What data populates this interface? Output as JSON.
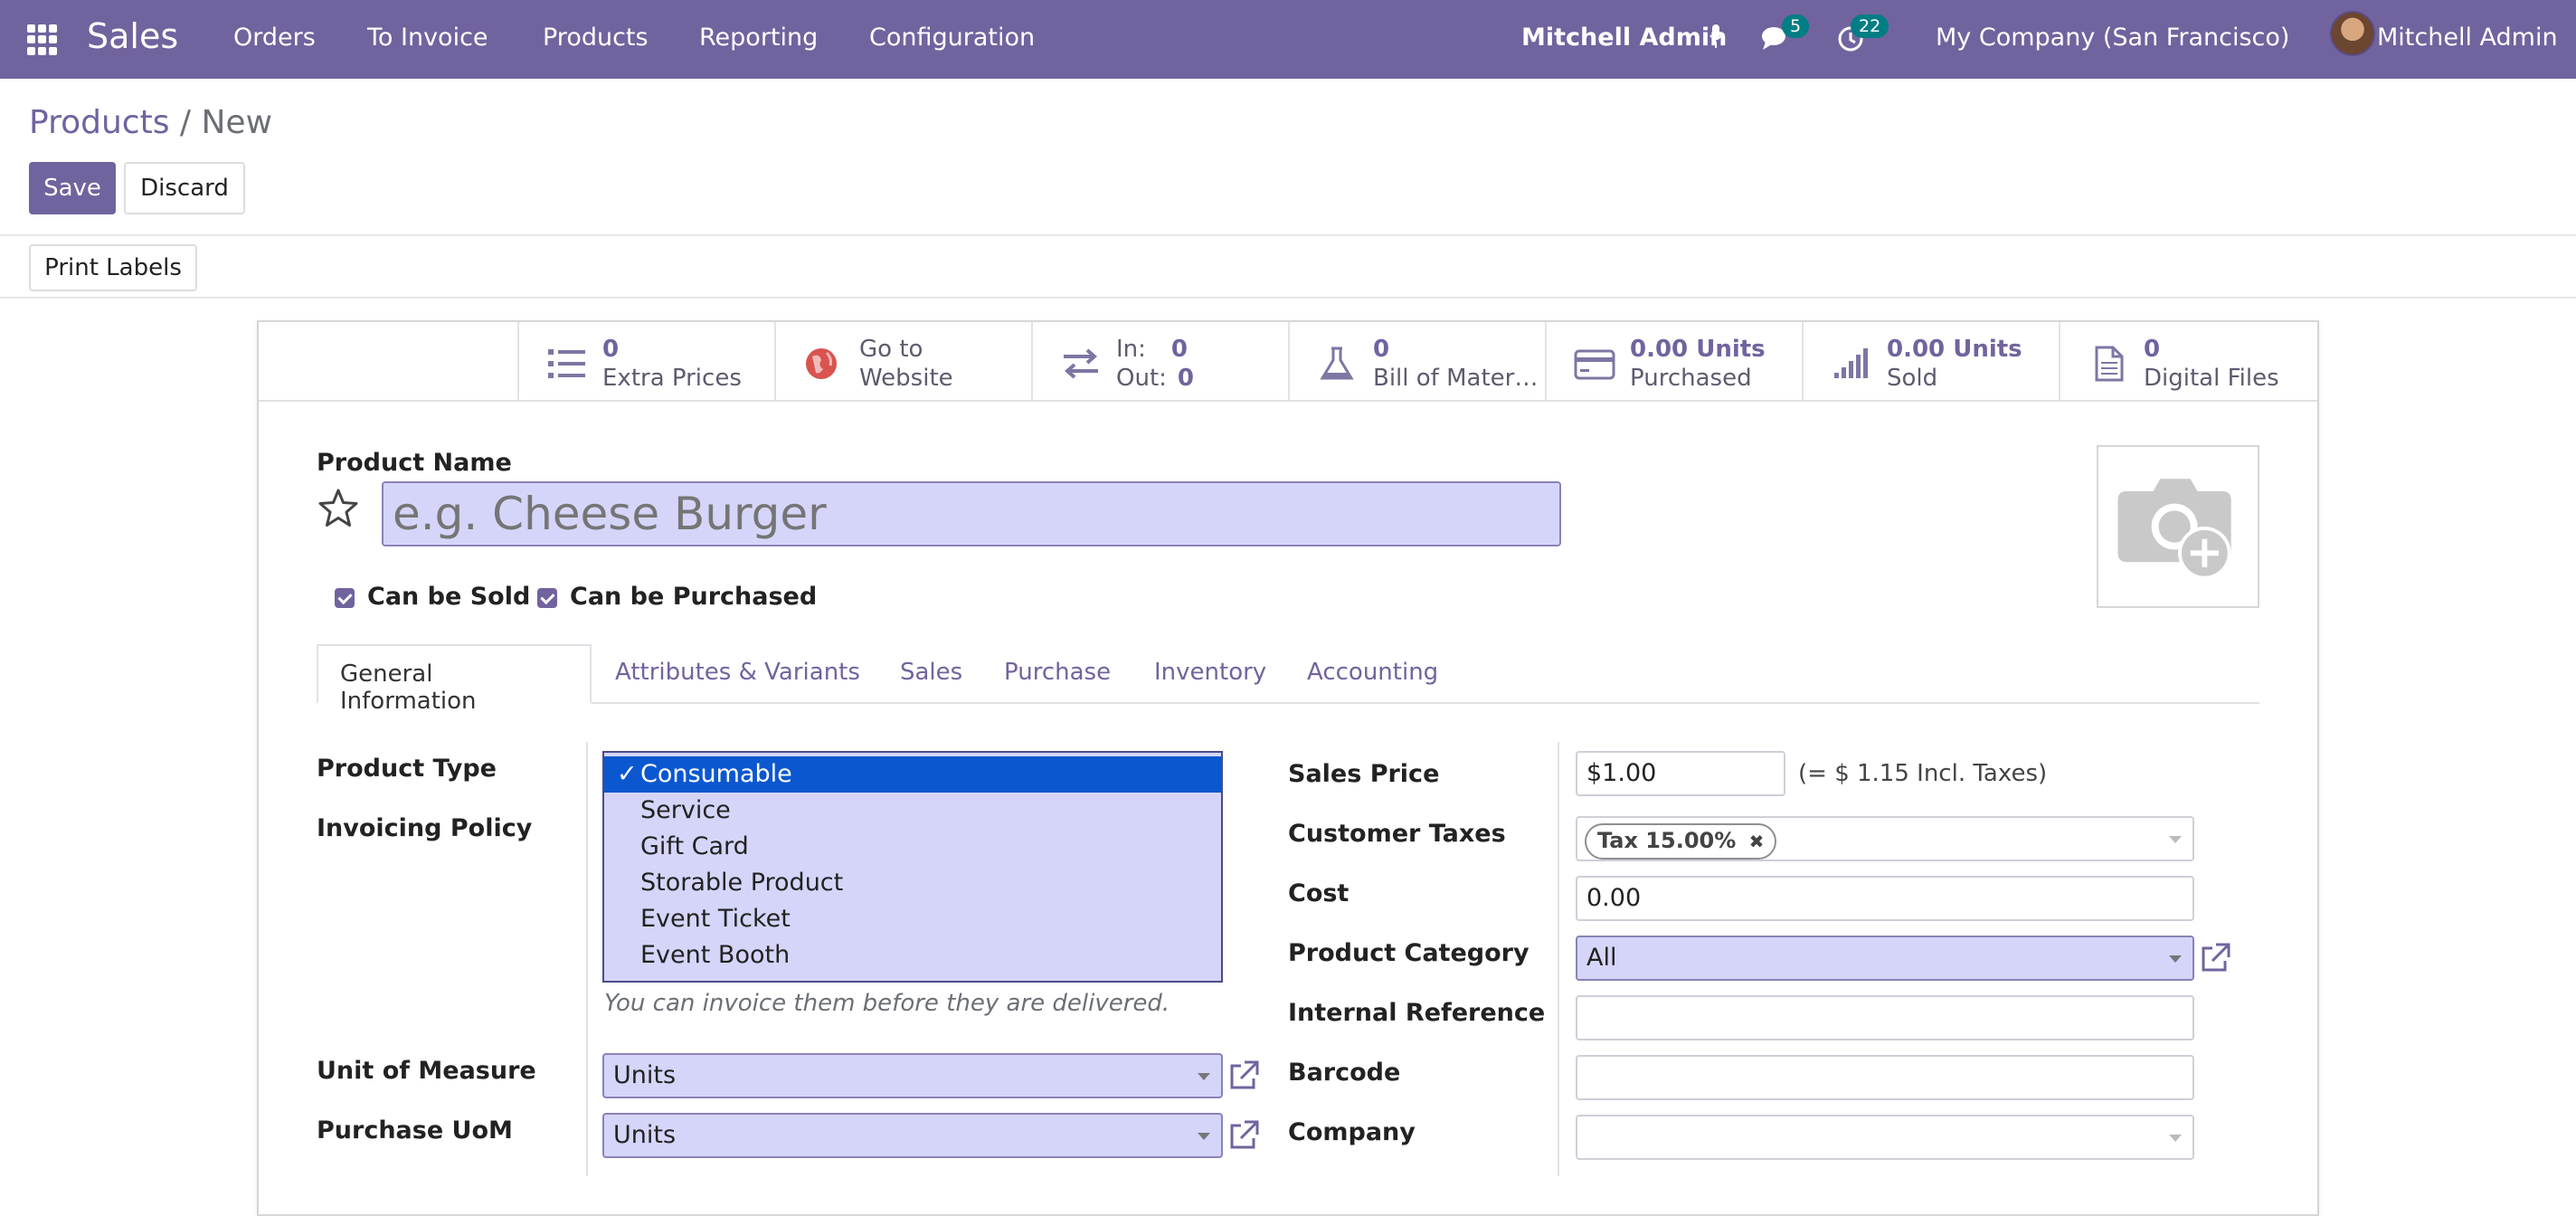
{
  "nav": {
    "app_name": "Sales",
    "menu": [
      "Orders",
      "To Invoice",
      "Products",
      "Reporting",
      "Configuration"
    ],
    "user_bold": "Mitchell Admin",
    "messages_count": "5",
    "activities_count": "22",
    "company": "My Company (San Francisco)",
    "user": "Mitchell Admin"
  },
  "breadcrumb": {
    "parent": "Products",
    "separator": "/",
    "current": "New"
  },
  "buttons": {
    "save": "Save",
    "discard": "Discard",
    "print_labels": "Print Labels"
  },
  "smart_buttons": [
    {
      "value": "0",
      "label": "Extra Prices",
      "icon": "list-icon"
    },
    {
      "value": "Go to",
      "label": "Website",
      "icon": "globe-icon"
    },
    {
      "in_label": "In:",
      "in_value": "0",
      "out_label": "Out:",
      "out_value": "0",
      "icon": "arrows-exchange-icon"
    },
    {
      "value": "0",
      "label": "Bill of Mater…",
      "icon": "flask-icon"
    },
    {
      "value": "0.00 Units",
      "label": "Purchased",
      "icon": "credit-card-icon"
    },
    {
      "value": "0.00 Units",
      "label": "Sold",
      "icon": "signal-bars-icon"
    },
    {
      "value": "0",
      "label": "Digital Files",
      "icon": "file-icon"
    }
  ],
  "product": {
    "name_label": "Product Name",
    "name_placeholder": "e.g. Cheese Burger",
    "can_be_sold": "Can be Sold",
    "can_be_purchased": "Can be Purchased"
  },
  "tabs": [
    "General Information",
    "Attributes & Variants",
    "Sales",
    "Purchase",
    "Inventory",
    "Accounting"
  ],
  "left_fields": {
    "product_type": "Product Type",
    "invoicing_policy": "Invoicing Policy",
    "invoicing_help": "You can invoice them before they are delivered.",
    "uom_label": "Unit of Measure",
    "uom_value": "Units",
    "purchase_uom_label": "Purchase UoM",
    "purchase_uom_value": "Units"
  },
  "product_type_options": [
    "Consumable",
    "Service",
    "Gift Card",
    "Storable Product",
    "Event Ticket",
    "Event Booth"
  ],
  "product_type_selected_check": "✓",
  "right_fields": {
    "sales_price_label": "Sales Price",
    "sales_price_value": "$1.00",
    "sales_price_incl": "(= $ 1.15 Incl. Taxes)",
    "customer_taxes_label": "Customer Taxes",
    "tax_tag": "Tax 15.00%",
    "tax_remove": "✖",
    "cost_label": "Cost",
    "cost_value": "0.00",
    "category_label": "Product Category",
    "category_value": "All",
    "internal_ref_label": "Internal Reference",
    "barcode_label": "Barcode",
    "company_label": "Company"
  }
}
